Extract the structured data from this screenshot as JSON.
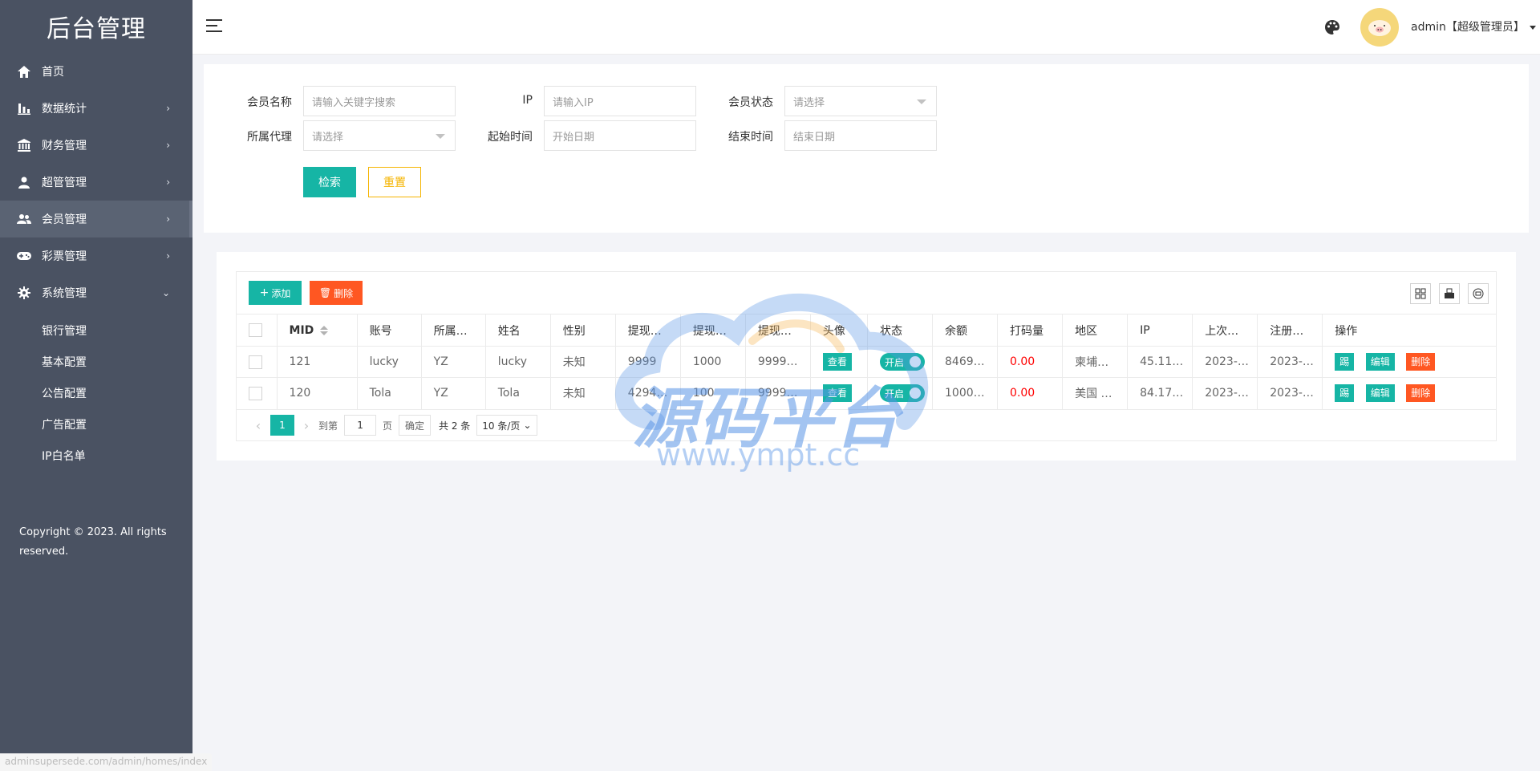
{
  "app": {
    "logo": "后台管理",
    "user": "admin【超级管理员】",
    "copyright": "Copyright © 2023. All rights reserved."
  },
  "sidebar": {
    "items": [
      {
        "label": "首页",
        "icon": "home-icon"
      },
      {
        "label": "数据统计",
        "icon": "bar-chart-icon"
      },
      {
        "label": "财务管理",
        "icon": "bank-icon"
      },
      {
        "label": "超管管理",
        "icon": "user-icon"
      },
      {
        "label": "会员管理",
        "icon": "users-icon"
      },
      {
        "label": "彩票管理",
        "icon": "gamepad-icon"
      },
      {
        "label": "系统管理",
        "icon": "gear-icon"
      }
    ],
    "sub_items": [
      "银行管理",
      "基本配置",
      "公告配置",
      "广告配置",
      "IP白名单"
    ]
  },
  "search": {
    "member_name_label": "会员名称",
    "member_name_placeholder": "请输入关键字搜索",
    "ip_label": "IP",
    "ip_placeholder": "请输入IP",
    "member_status_label": "会员状态",
    "member_status_placeholder": "请选择",
    "agent_label": "所属代理",
    "agent_placeholder": "请选择",
    "start_label": "起始时间",
    "start_placeholder": "开始日期",
    "end_label": "结束时间",
    "end_placeholder": "结束日期",
    "search_button": "检索",
    "reset_button": "重置"
  },
  "toolbar": {
    "add_label": "添加",
    "delete_label": "删除"
  },
  "table": {
    "headers": [
      "MID",
      "账号",
      "所属…",
      "姓名",
      "性别",
      "提现…",
      "提现…",
      "提现…",
      "头像",
      "状态",
      "余额",
      "打码量",
      "地区",
      "IP",
      "上次…",
      "注册…",
      "操作"
    ],
    "rows": [
      {
        "mid": "121",
        "account": "lucky",
        "agent": "YZ",
        "name": "lucky",
        "gender": "未知",
        "w1": "9999",
        "w2": "1000",
        "w3": "9999…",
        "avatar_btn": "查看",
        "status": "开启",
        "balance": "8469…",
        "bet": "0.00",
        "region": "柬埔…",
        "ip": "45.11…",
        "last": "2023-…",
        "reg": "2023-…"
      },
      {
        "mid": "120",
        "account": "Tola",
        "agent": "YZ",
        "name": "Tola",
        "gender": "未知",
        "w1": "4294…",
        "w2": "100",
        "w3": "9999…",
        "avatar_btn": "查看",
        "status": "开启",
        "balance": "1000…",
        "bet": "0.00",
        "region": "美国 …",
        "ip": "84.17…",
        "last": "2023-…",
        "reg": "2023-…"
      }
    ],
    "actions": {
      "shortcut": "踢",
      "edit": "编辑",
      "delete": "删除"
    }
  },
  "pager": {
    "current": "1",
    "goto_label": "到第",
    "page_input": "1",
    "page_unit": "页",
    "confirm": "确定",
    "total": "共 2 条",
    "size": "10 条/页"
  },
  "watermark": {
    "text": "源码平台",
    "url": "www.ympt.cc"
  },
  "status_bar_url": "adminsupersede.com/admin/homes/index",
  "colors": {
    "sidebar": "#4a5262",
    "primary": "#16b5a5",
    "danger": "#ff5722",
    "warning": "#f5b400"
  }
}
